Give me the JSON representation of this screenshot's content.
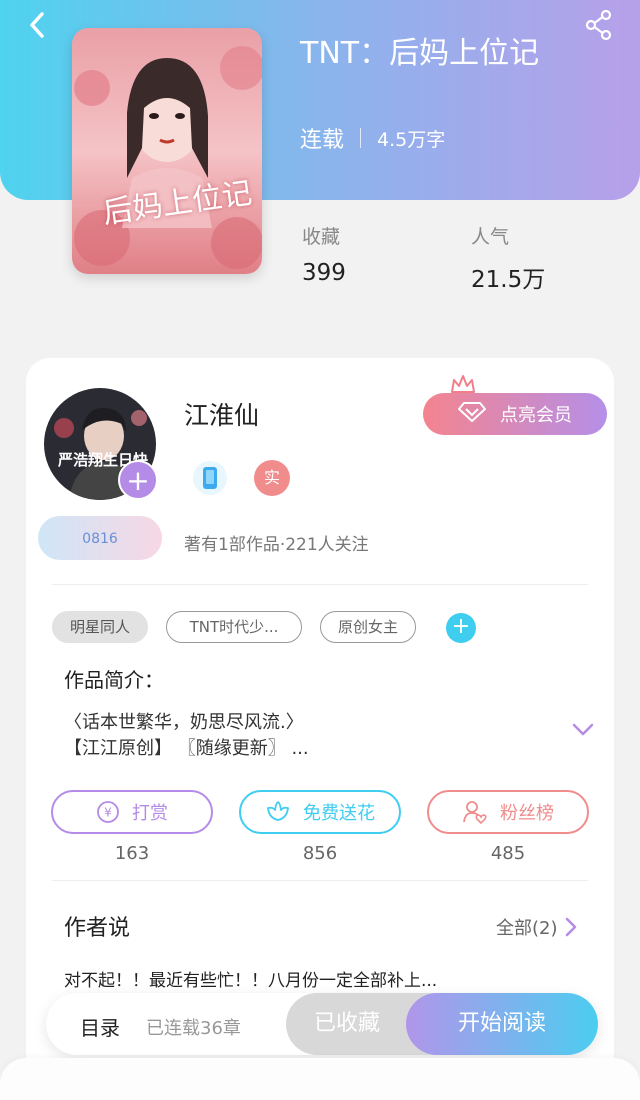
{
  "header": {
    "back_icon": "chevron-left-icon",
    "share_icon": "share-icon",
    "book_title": "TNT：后妈上位记",
    "status": "连载",
    "word_count": "4.5万字",
    "stats": [
      {
        "label": "收藏",
        "value": "399"
      },
      {
        "label": "人气",
        "value": "21.5万"
      }
    ],
    "cover_text": "后妈上位记",
    "gradient_colors": [
      "#4fd3ef",
      "#b7a0ea"
    ]
  },
  "author": {
    "name": "江淮仙",
    "avatar_text": "严浩翔生日快",
    "avatar_add_label": "+",
    "real_badge": "实",
    "vip_button": "点亮会员",
    "fan_badge": "0816",
    "meta": "著有1部作品·221人关注"
  },
  "tags": {
    "items": [
      "明星同人",
      "TNT时代少...",
      "原创女主"
    ],
    "add_label": "+"
  },
  "intro": {
    "title": "作品简介：",
    "line1": "〈话本世繁华，奶思尽风流.〉",
    "line2": "【江江原创】 〖随缘更新〗 ..."
  },
  "actions": [
    {
      "label": "打赏",
      "count": "163",
      "color": "#b48be6"
    },
    {
      "label": "免费送花",
      "count": "856",
      "color": "#3fcdf0"
    },
    {
      "label": "粉丝榜",
      "count": "485",
      "color": "#f08c8c"
    }
  ],
  "author_say": {
    "title": "作者说",
    "all_label": "全部(2)",
    "text": "对不起！！最近有些忙！！八月份一定全部补上..."
  },
  "bottom_bar": {
    "catalog": "目录",
    "chapters": "已连载36章",
    "collected": "已收藏",
    "start_reading": "开始阅读"
  }
}
